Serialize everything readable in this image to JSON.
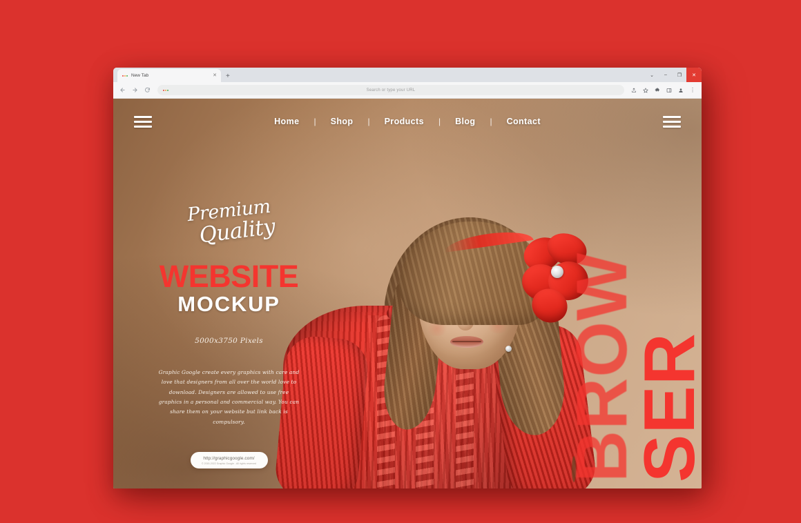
{
  "canvas": {
    "background_color": "#db322d"
  },
  "browser": {
    "tab": {
      "title": "New Tab",
      "favicon": "three-dot-favicon",
      "close_label": "✕"
    },
    "new_tab_label": "+",
    "window_controls": [
      {
        "name": "chevron-down",
        "glyph": "⌄"
      },
      {
        "name": "minimize",
        "glyph": "–"
      },
      {
        "name": "maximize",
        "glyph": "❐"
      },
      {
        "name": "close",
        "glyph": "✕"
      }
    ],
    "toolbar": {
      "back_label": "back-arrow",
      "forward_label": "forward-arrow",
      "reload_label": "reload-arrow",
      "omnibox_placeholder": "Search or type your URL",
      "omnibox_value": "",
      "actions": [
        {
          "name": "share-icon"
        },
        {
          "name": "bookmark-star-icon"
        },
        {
          "name": "extensions-puzzle-icon"
        },
        {
          "name": "side-panel-icon"
        },
        {
          "name": "profile-icon"
        },
        {
          "name": "more-menu-icon",
          "glyph": "⋮"
        }
      ]
    }
  },
  "site": {
    "nav": {
      "menu_icon_left": "hamburger-menu-icon",
      "menu_icon_right": "hamburger-menu-icon",
      "separator": "|",
      "links": [
        {
          "label": "Home"
        },
        {
          "label": "Shop"
        },
        {
          "label": "Products"
        },
        {
          "label": "Blog"
        },
        {
          "label": "Contact"
        }
      ]
    },
    "hero": {
      "script_line_1": "Premium",
      "script_line_2": "Quality",
      "headline_red": "WEBSITE",
      "headline_white": "MOCKUP",
      "dimensions": "5000x3750 Pixels",
      "blurb": "Graphic Google create every graphics with care and love that designers from all over the world love to download. Designers are allowed to use free graphics in a personal and commercial way. You can share them on your website but link back is compulsory.",
      "url_pill": {
        "url": "http://graphicgoogle.com/",
        "copyright": "© 2015-2022 Graphic Google - All rights reserved"
      }
    },
    "vertical_type": {
      "word_top": "BROW",
      "word_bottom": "SER",
      "color": "#f4352f"
    },
    "photo": {
      "subject": "young-girl-portrait",
      "hair_color": "#8d6440",
      "sweater_color": "#e02a20",
      "bow_color": "#e32a1f",
      "backdrop_color": "#bd9471"
    }
  }
}
